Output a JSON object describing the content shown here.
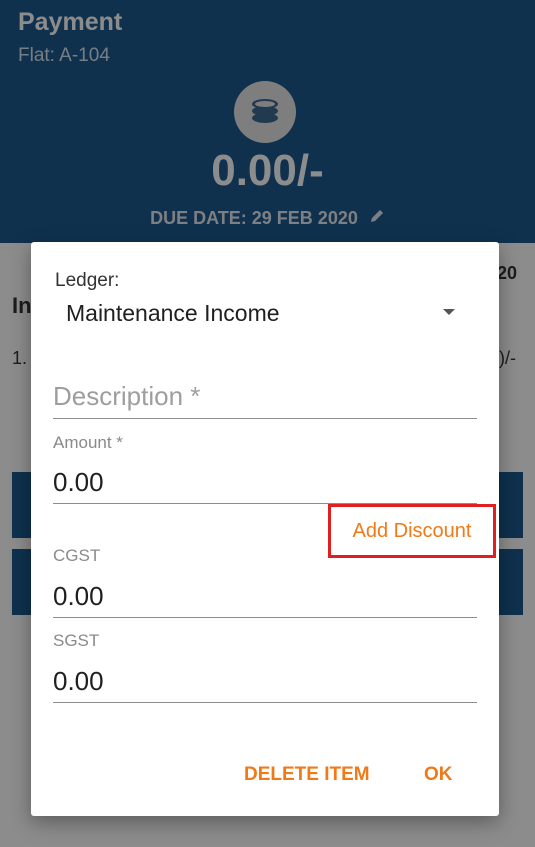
{
  "header": {
    "title": "Payment",
    "subtitle": "Flat: A-104",
    "amount": "0.00/-",
    "due_date": "DUE DATE: 29 FEB 2020",
    "icons": {
      "coin": "coins-icon",
      "edit": "pencil-icon"
    }
  },
  "background": {
    "partial_top_right": "20",
    "partial_left_heading": "In",
    "partial_left_row": "1.",
    "partial_right_row": ")/-"
  },
  "dialog": {
    "ledger_label": "Ledger:",
    "ledger_value": "Maintenance Income",
    "description_placeholder": "Description *",
    "amount_label": "Amount *",
    "amount_value": "0.00",
    "add_discount": "Add Discount",
    "cgst_label": "CGST",
    "cgst_value": "0.00",
    "sgst_label": "SGST",
    "sgst_value": "0.00",
    "delete_label": "DELETE ITEM",
    "ok_label": "OK"
  },
  "colors": {
    "header_bg": "#1c5a8e",
    "accent": "#f07a18",
    "highlight_box": "#e02020"
  }
}
